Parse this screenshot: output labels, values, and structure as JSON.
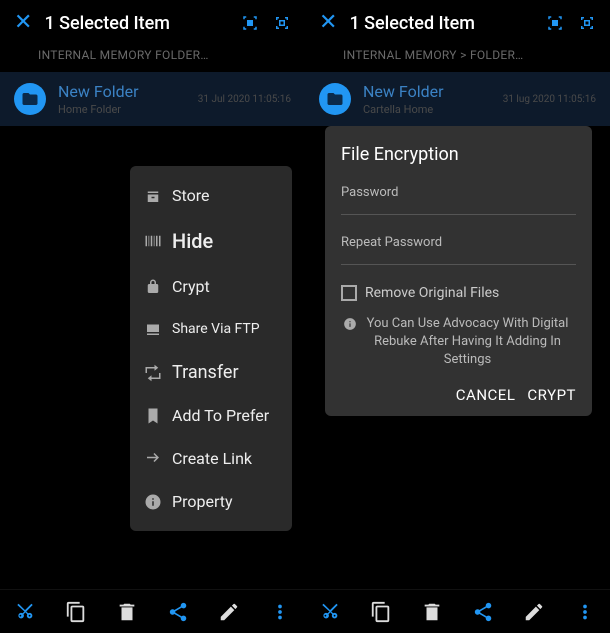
{
  "left": {
    "header": {
      "title": "1 Selected Item"
    },
    "breadcrumb": "INTERNAL MEMORY FOLDER…",
    "folder": {
      "name": "New Folder",
      "subtitle": "Home Folder",
      "date": "31 Jul 2020  11:05:16"
    },
    "menu": {
      "store": "Store",
      "hide": "Hide",
      "crypt": "Crypt",
      "share_ftp": "Share Via FTP",
      "transfer": "Transfer",
      "add_to_prefer": "Add To Prefer",
      "create_link": "Create Link",
      "property": "Property"
    }
  },
  "right": {
    "header": {
      "title": "1 Selected Item"
    },
    "breadcrumb": "INTERNAL MEMORY > FOLDER…",
    "folder": {
      "name": "New Folder",
      "subtitle": "Cartella Home",
      "date": "31 lug 2020  11:05:16"
    },
    "dialog": {
      "title": "File Encryption",
      "password_label": "Password",
      "repeat_label": "Repeat Password",
      "remove_original": "Remove Original Files",
      "advisory": "You Can Use Advocacy With Digital Rebuke After Having It Adding In Settings",
      "cancel": "CANCEL",
      "confirm": "CRYPT"
    }
  },
  "toolbar_icons": [
    "cut",
    "copy",
    "delete",
    "share",
    "edit",
    "more"
  ]
}
